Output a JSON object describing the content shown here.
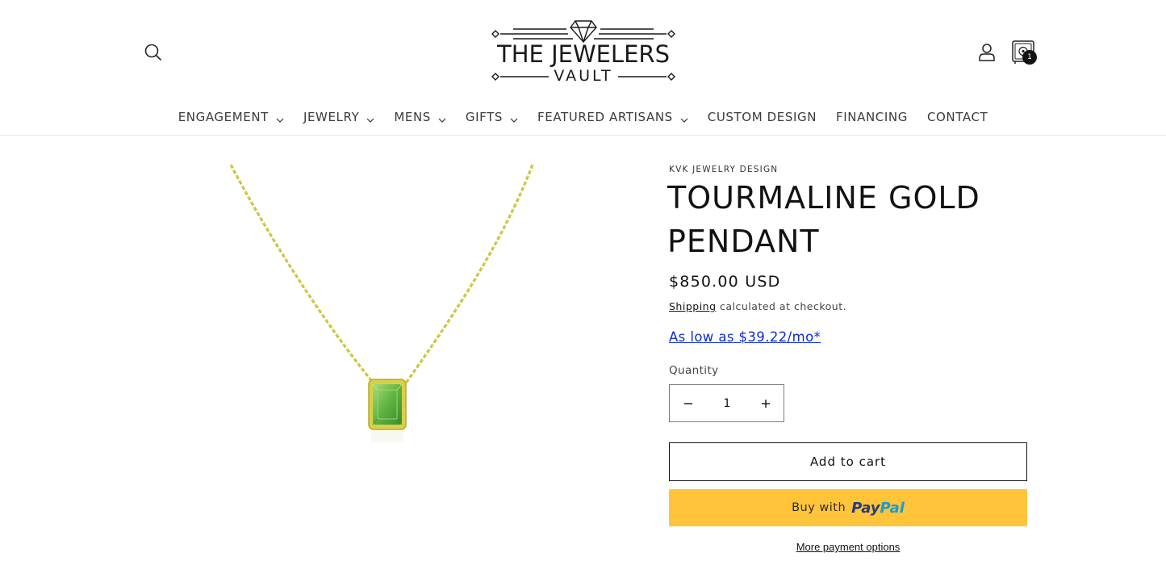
{
  "header": {
    "logo": {
      "top_text": "THE JEWELERS",
      "bottom_text": "VAULT"
    },
    "cart_count": "1",
    "nav": [
      {
        "label": "ENGAGEMENT",
        "dropdown": true
      },
      {
        "label": "JEWELRY",
        "dropdown": true
      },
      {
        "label": "MENS",
        "dropdown": true
      },
      {
        "label": "GIFTS",
        "dropdown": true
      },
      {
        "label": "FEATURED ARTISANS",
        "dropdown": true
      },
      {
        "label": "CUSTOM DESIGN",
        "dropdown": false
      },
      {
        "label": "FINANCING",
        "dropdown": false
      },
      {
        "label": "CONTACT",
        "dropdown": false
      }
    ]
  },
  "product": {
    "vendor": "KVK JEWELRY DESIGN",
    "title": "TOURMALINE GOLD PENDANT",
    "price": "$850.00 USD",
    "shipping_link": "Shipping",
    "shipping_text": " calculated at checkout.",
    "financing": "As low as $39.22/mo*",
    "quantity_label": "Quantity",
    "quantity": "1",
    "add_to_cart": "Add to cart",
    "paypal_prefix": "Buy with",
    "paypal_logo_pay": "Pay",
    "paypal_logo_pal": "Pal",
    "more_payment_options": "More payment options"
  },
  "icons": {
    "search": "search-icon",
    "account": "user-icon",
    "cart": "vault-cart-icon",
    "chevron": "chevron-down-icon"
  },
  "colors": {
    "paypal_yellow": "#ffc439",
    "financing_link": "#0a2bd6",
    "gem_green": "#5fb341",
    "gold": "#c9c33a"
  }
}
